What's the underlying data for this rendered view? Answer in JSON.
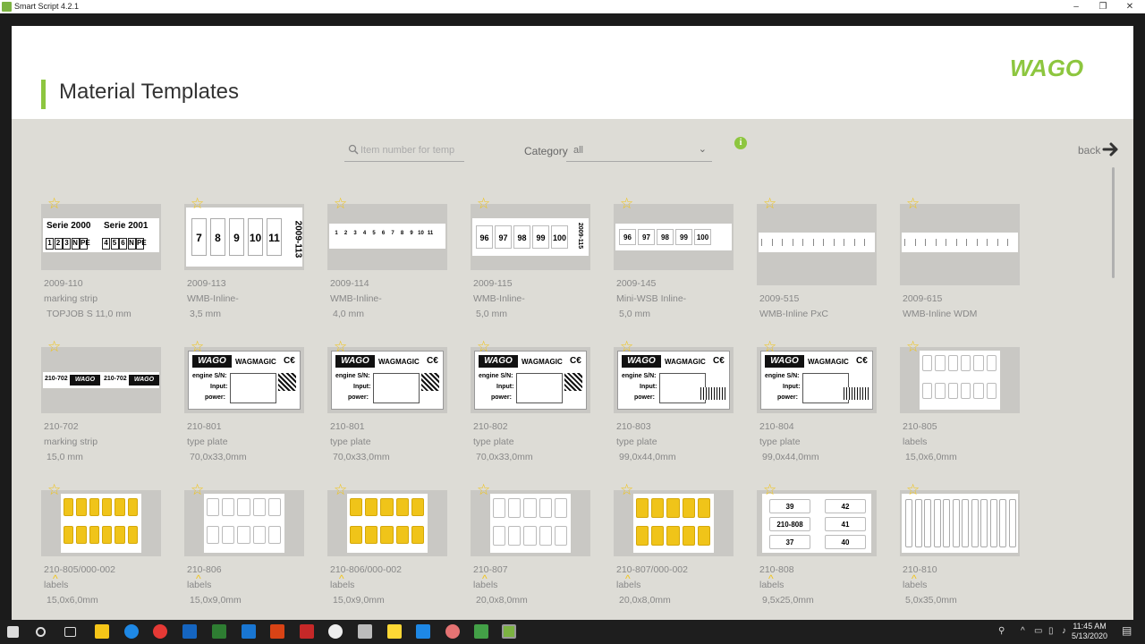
{
  "window": {
    "title": "Smart Script 4.2.1",
    "min": "–",
    "max": "❐",
    "close": "✕"
  },
  "header": {
    "page_title": "Material Templates",
    "logo_text": "WAGO"
  },
  "toolbar": {
    "search_placeholder": "Item number for temp",
    "category_label": "Category",
    "category_value": "all",
    "info": "i",
    "back_label": "back"
  },
  "colors": {
    "accent": "#8dc63f",
    "star": "#f0c419",
    "label_yellow": "#f0c419"
  },
  "cards": [
    {
      "id": "2009-110",
      "type": "marking strip",
      "size": "TOPJOB S 11,0 mm"
    },
    {
      "id": "2009-113",
      "type": "WMB-Inline-",
      "size": "3,5 mm"
    },
    {
      "id": "2009-114",
      "type": "WMB-Inline-",
      "size": "4,0 mm"
    },
    {
      "id": "2009-115",
      "type": "WMB-Inline-",
      "size": "5,0 mm"
    },
    {
      "id": "2009-145",
      "type": "Mini-WSB Inline-",
      "size": "5,0 mm"
    },
    {
      "id": "2009-515",
      "type": "WMB-Inline PxC",
      "size": ""
    },
    {
      "id": "2009-615",
      "type": "WMB-Inline WDM",
      "size": ""
    },
    {
      "id": "210-702",
      "type": "marking strip",
      "size": "15,0 mm"
    },
    {
      "id": "210-801",
      "type": "type plate",
      "size": "70,0x33,0mm"
    },
    {
      "id": "210-801",
      "type": "type plate",
      "size": "70,0x33,0mm"
    },
    {
      "id": "210-802",
      "type": "type plate",
      "size": "70,0x33,0mm"
    },
    {
      "id": "210-803",
      "type": "type plate",
      "size": "99,0x44,0mm"
    },
    {
      "id": "210-804",
      "type": "type plate",
      "size": "99,0x44,0mm"
    },
    {
      "id": "210-805",
      "type": "labels",
      "size": "15,0x6,0mm"
    },
    {
      "id": "210-805/000-002",
      "type": "labels",
      "size": "15,0x6,0mm"
    },
    {
      "id": "210-806",
      "type": "labels",
      "size": "15,0x9,0mm"
    },
    {
      "id": "210-806/000-002",
      "type": "labels",
      "size": "15,0x9,0mm"
    },
    {
      "id": "210-807",
      "type": "labels",
      "size": "20,0x8,0mm"
    },
    {
      "id": "210-807/000-002",
      "type": "labels",
      "size": "20,0x8,0mm"
    },
    {
      "id": "210-808",
      "type": "labels",
      "size": "9,5x25,0mm"
    },
    {
      "id": "210-810",
      "type": "labels",
      "size": "5,0x35,0mm"
    }
  ],
  "thumbs": {
    "serie_a": "Serie 2000",
    "serie_b": "Serie 2001",
    "serie_a_cells": [
      "1",
      "2",
      "3",
      "N",
      "PE"
    ],
    "serie_b_cells": [
      "4",
      "5",
      "6",
      "N",
      "PE"
    ],
    "wmb113": [
      "7",
      "8",
      "9",
      "10",
      "11"
    ],
    "wmb113_side": "2009-113",
    "wmb114": [
      "1",
      "2",
      "3",
      "4",
      "5",
      "6",
      "7",
      "8",
      "9",
      "10",
      "11"
    ],
    "wmb115": [
      "96",
      "97",
      "98",
      "99",
      "100"
    ],
    "wmb115_side": "2009-115",
    "wmb145": [
      "96",
      "97",
      "98",
      "99",
      "100"
    ],
    "plate_brand": "WAGO",
    "plate_magic": "WAGMAGIC",
    "plate_ce": "C€",
    "plate_engine": "engine S/N:",
    "plate_input": "Input:",
    "plate_power": "power:",
    "strip702_a": "210-702",
    "strip702_b": "210-702",
    "l808_a": "39",
    "l808_b": "42",
    "l808_c": "210-808",
    "l808_d": "41",
    "l808_e": "37",
    "l808_f": "40"
  },
  "taskbar": {
    "time": "11:45 AM",
    "date": "5/13/2020"
  }
}
